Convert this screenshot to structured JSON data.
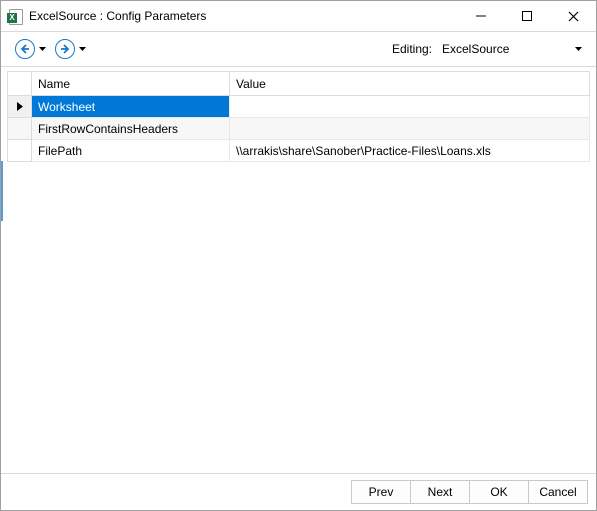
{
  "window": {
    "title": "ExcelSource : Config Parameters"
  },
  "toolbar": {
    "editing_label": "Editing:",
    "editing_value": "ExcelSource"
  },
  "grid": {
    "columns": {
      "name": "Name",
      "value": "Value"
    },
    "rows": [
      {
        "name": "Worksheet",
        "value": "",
        "selected": true,
        "alt": false
      },
      {
        "name": "FirstRowContainsHeaders",
        "value": "",
        "selected": false,
        "alt": true
      },
      {
        "name": "FilePath",
        "value": "\\\\arrakis\\share\\Sanober\\Practice-Files\\Loans.xls",
        "selected": false,
        "alt": false
      }
    ]
  },
  "footer": {
    "prev": "Prev",
    "next": "Next",
    "ok": "OK",
    "cancel": "Cancel"
  }
}
